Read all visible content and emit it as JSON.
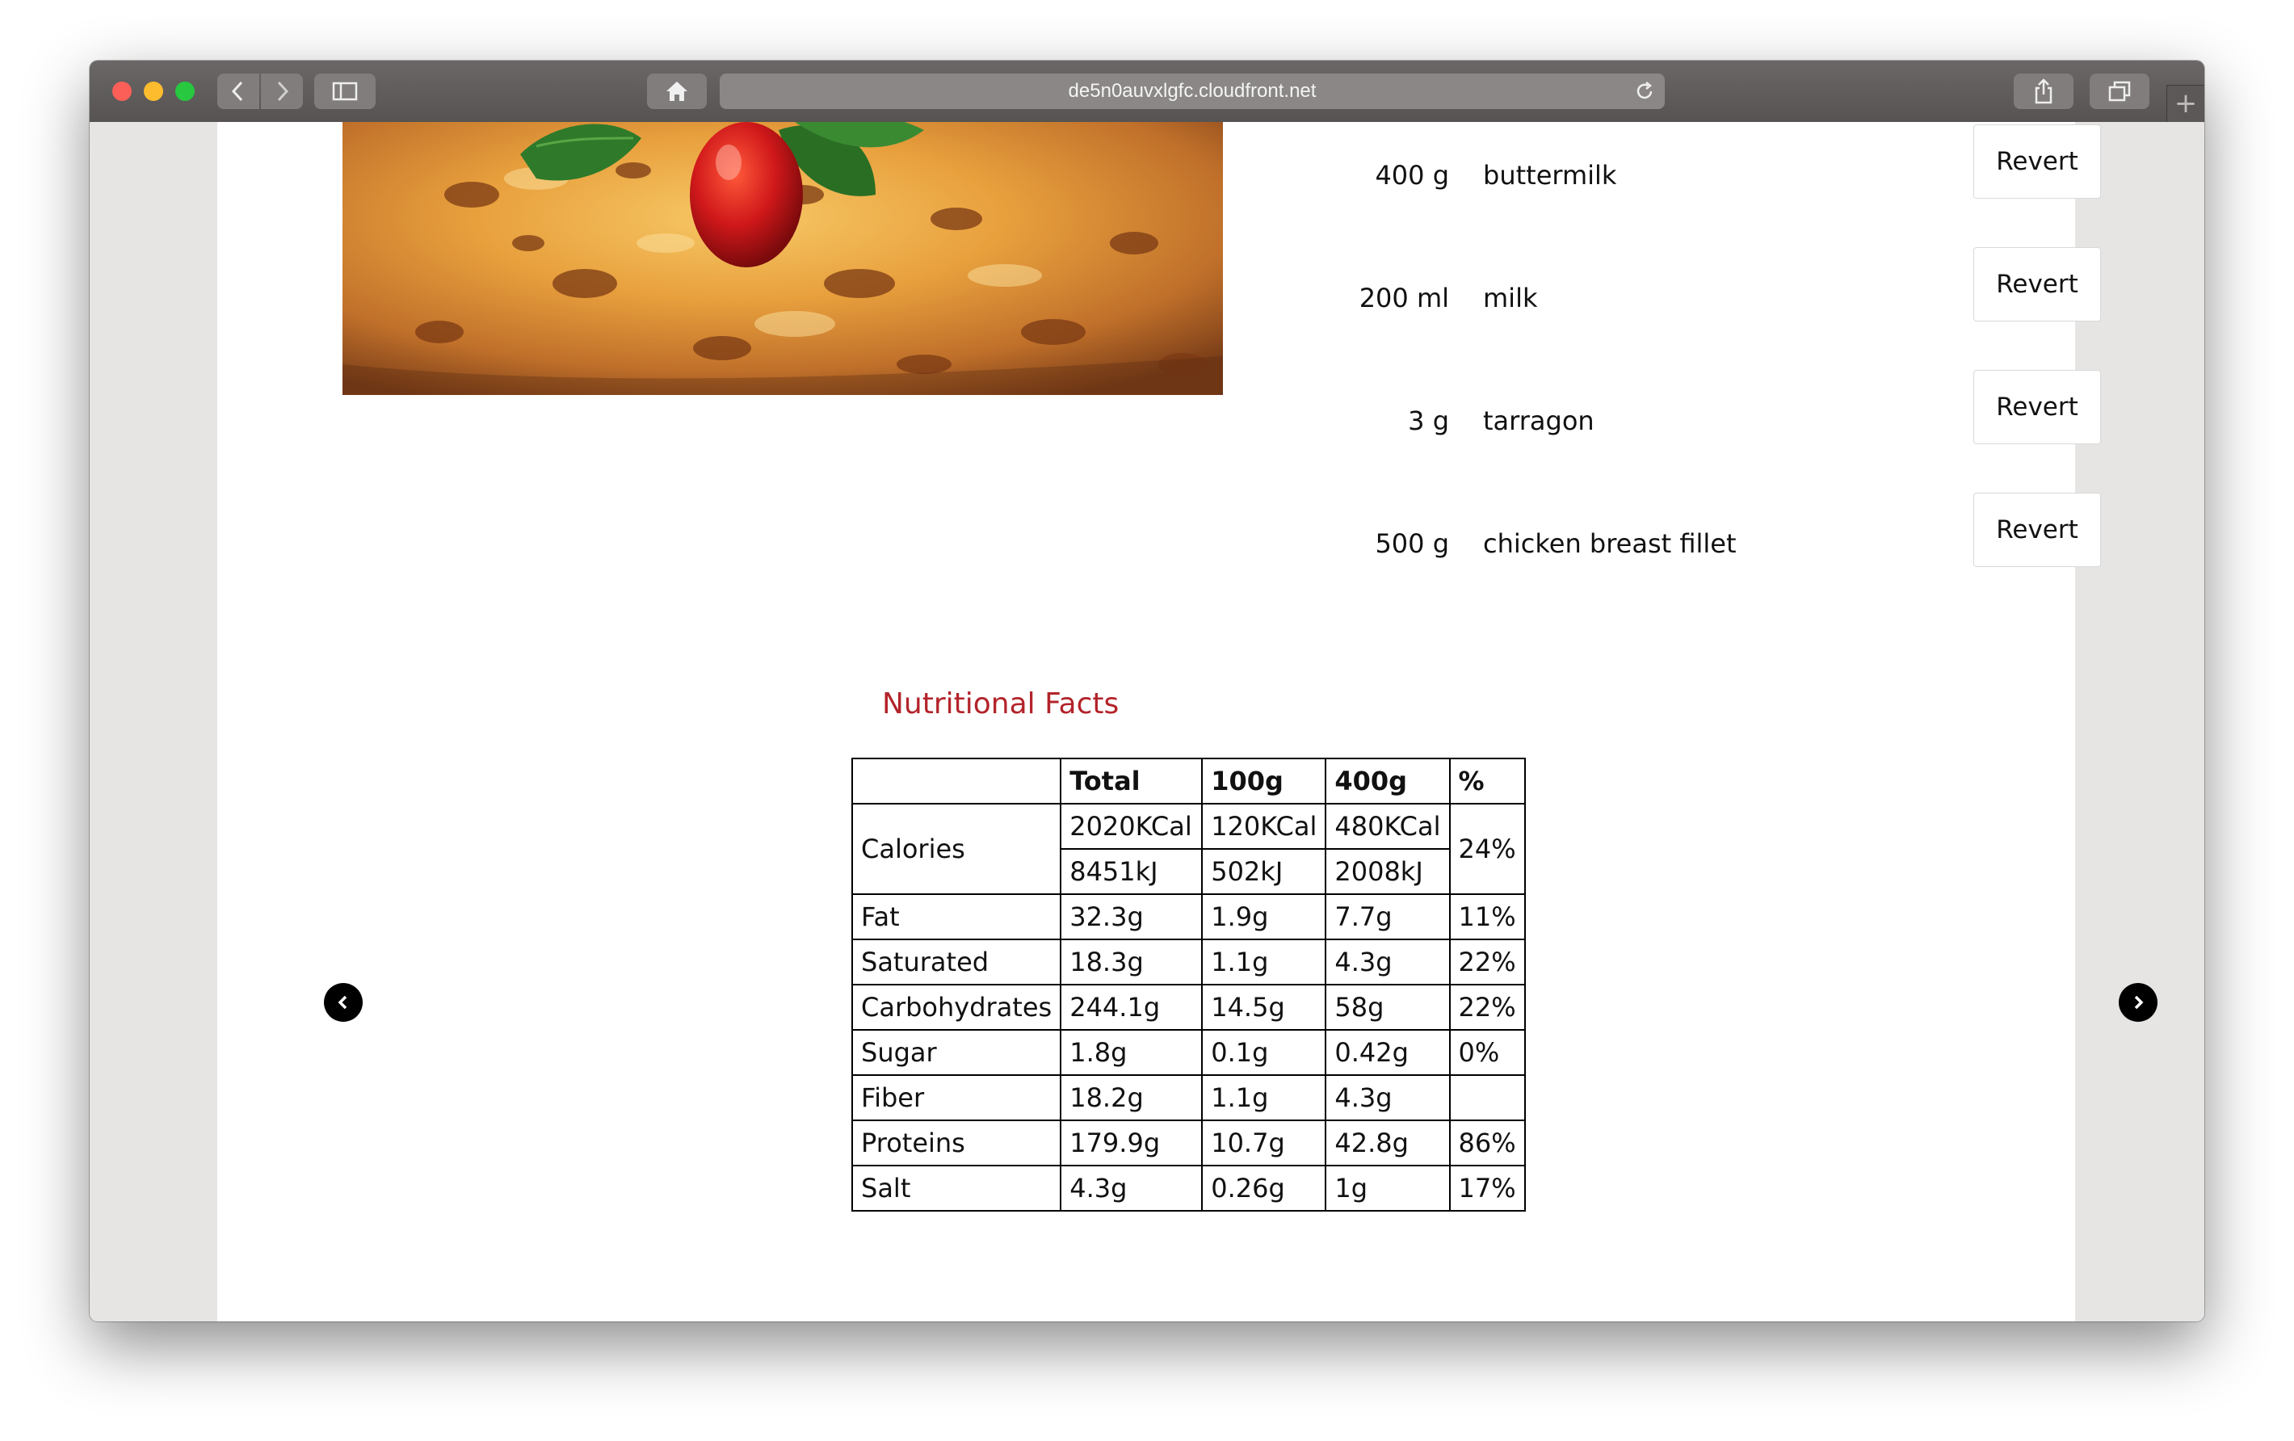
{
  "browser": {
    "url": "de5n0auvxlgfc.cloudfront.net",
    "back_icon": "chevron-left-icon",
    "forward_icon": "chevron-right-icon",
    "sidebar_icon": "sidebar-icon",
    "home_icon": "home-icon",
    "reload_icon": "reload-icon",
    "share_icon": "share-icon",
    "tabs_icon": "tabs-icon",
    "new_tab_label": "+"
  },
  "ingredients": [
    {
      "qty": "400 g",
      "name": "buttermilk",
      "button": "Revert"
    },
    {
      "qty": "200 ml",
      "name": "milk",
      "button": "Revert"
    },
    {
      "qty": "3 g",
      "name": "tarragon",
      "button": "Revert"
    },
    {
      "qty": "500 g",
      "name": "chicken breast fillet",
      "button": "Revert"
    }
  ],
  "nutrition": {
    "title": "Nutritional Facts",
    "headers": [
      "",
      "Total",
      "100g",
      "400g",
      "%"
    ],
    "calories": {
      "label": "Calories",
      "kcal": [
        "2020KCal",
        "120KCal",
        "480KCal"
      ],
      "kj": [
        "8451kJ",
        "502kJ",
        "2008kJ"
      ],
      "percent": "24%"
    },
    "rows": [
      {
        "label": "Fat",
        "total": "32.3g",
        "per100": "1.9g",
        "per400": "7.7g",
        "percent": "11%"
      },
      {
        "label": "Saturated",
        "total": "18.3g",
        "per100": "1.1g",
        "per400": "4.3g",
        "percent": "22%"
      },
      {
        "label": "Carbohydrates",
        "total": "244.1g",
        "per100": "14.5g",
        "per400": "58g",
        "percent": "22%"
      },
      {
        "label": "Sugar",
        "total": "1.8g",
        "per100": "0.1g",
        "per400": "0.42g",
        "percent": "0%"
      },
      {
        "label": "Fiber",
        "total": "18.2g",
        "per100": "1.1g",
        "per400": "4.3g",
        "percent": ""
      },
      {
        "label": "Proteins",
        "total": "179.9g",
        "per100": "10.7g",
        "per400": "42.8g",
        "percent": "86%"
      },
      {
        "label": "Salt",
        "total": "4.3g",
        "per100": "0.26g",
        "per400": "1g",
        "percent": "17%"
      }
    ]
  },
  "carousel": {
    "prev_icon": "chevron-left-circle-icon",
    "next_icon": "chevron-right-circle-icon"
  },
  "colors": {
    "title_red": "#b3232a",
    "window_chrome": "#5e5b5a"
  }
}
